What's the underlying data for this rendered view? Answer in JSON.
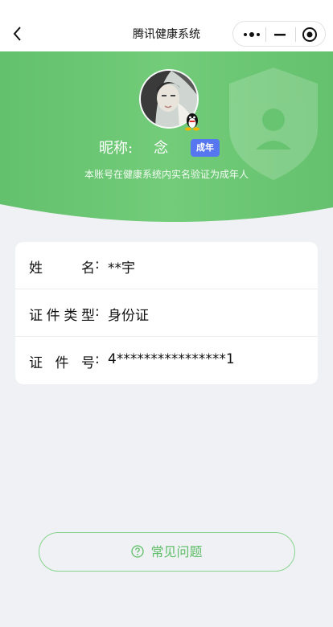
{
  "header": {
    "title": "腾讯健康系统"
  },
  "profile": {
    "nickname_label": "昵称:",
    "nickname_value": "念",
    "adult_tag": "成年",
    "verify_note": "本账号在健康系统内实名验证为成年人"
  },
  "info": {
    "rows": [
      {
        "label": "姓名",
        "value": "**宇"
      },
      {
        "label": "证件类型",
        "value": "身份证"
      },
      {
        "label": "证件号",
        "value": "4****************1"
      }
    ]
  },
  "faq": {
    "label": "常见问题"
  },
  "colors": {
    "banner_green": "#6cc673",
    "tag_blue": "#5677f0",
    "faq_green": "#5fbf69"
  }
}
